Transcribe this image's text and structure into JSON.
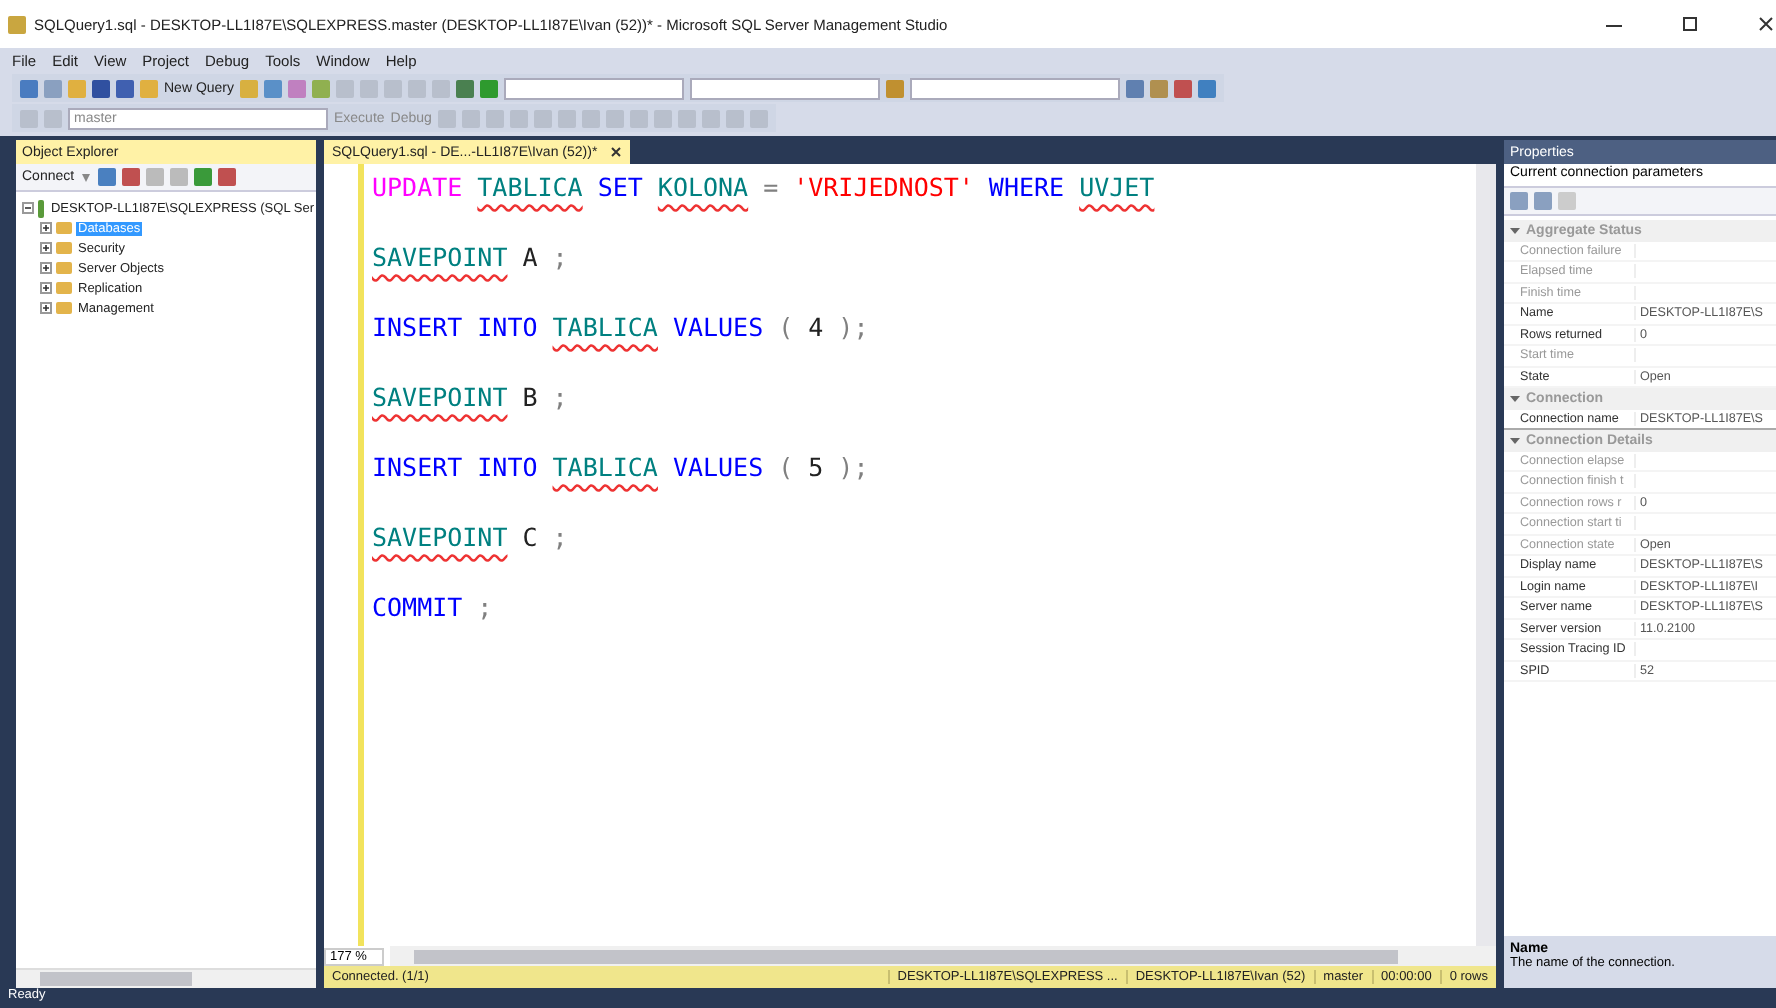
{
  "window": {
    "title": "SQLQuery1.sql - DESKTOP-LL1I87E\\SQLEXPRESS.master (DESKTOP-LL1I87E\\Ivan (52))* - Microsoft SQL Server Management Studio"
  },
  "menu": [
    "File",
    "Edit",
    "View",
    "Project",
    "Debug",
    "Tools",
    "Window",
    "Help"
  ],
  "toolbar": {
    "new_query": "New Query",
    "database": "master",
    "execute": "Execute",
    "debug": "Debug"
  },
  "object_explorer": {
    "title": "Object Explorer",
    "connect": "Connect",
    "tree": [
      {
        "label": "DESKTOP-LL1I87E\\SQLEXPRESS (SQL Ser",
        "expanded": true,
        "selected": false,
        "children": [
          {
            "label": "Databases",
            "expanded": false,
            "selected": true
          },
          {
            "label": "Security",
            "expanded": false,
            "selected": false
          },
          {
            "label": "Server Objects",
            "expanded": false,
            "selected": false
          },
          {
            "label": "Replication",
            "expanded": false,
            "selected": false
          },
          {
            "label": "Management",
            "expanded": false,
            "selected": false
          }
        ]
      }
    ]
  },
  "editor": {
    "tab": {
      "label": "SQLQuery1.sql - DE...-LL1I87E\\Ivan (52))*",
      "selected": true
    },
    "lines": [
      [
        {
          "kind": "special",
          "text": "UPDATE"
        },
        {
          "kind": "ident",
          "text": "TABLICA"
        },
        {
          "kind": "keyword",
          "text": "SET"
        },
        {
          "kind": "ident",
          "text": "KOLONA"
        },
        {
          "kind": "punct",
          "text": "="
        },
        {
          "kind": "string",
          "text": "'VRIJEDNOST'"
        },
        {
          "kind": "keyword",
          "text": "WHERE"
        },
        {
          "kind": "ident",
          "text": "UVJET"
        }
      ],
      [
        {
          "kind": "ident",
          "text": "SAVEPOINT"
        },
        {
          "kind": "plain",
          "text": "A"
        },
        {
          "kind": "punct",
          "text": ";"
        }
      ],
      [
        {
          "kind": "keyword",
          "text": "INSERT"
        },
        {
          "kind": "keyword",
          "text": "INTO"
        },
        {
          "kind": "ident",
          "text": "TABLICA"
        },
        {
          "kind": "keyword",
          "text": "VALUES"
        },
        {
          "kind": "punct",
          "text": "("
        },
        {
          "kind": "plain",
          "text": "4"
        },
        {
          "kind": "punct",
          "text": ");"
        }
      ],
      [
        {
          "kind": "ident",
          "text": "SAVEPOINT"
        },
        {
          "kind": "plain",
          "text": "B"
        },
        {
          "kind": "punct",
          "text": ";"
        }
      ],
      [
        {
          "kind": "keyword",
          "text": "INSERT"
        },
        {
          "kind": "keyword",
          "text": "INTO"
        },
        {
          "kind": "ident",
          "text": "TABLICA"
        },
        {
          "kind": "keyword",
          "text": "VALUES"
        },
        {
          "kind": "punct",
          "text": "("
        },
        {
          "kind": "plain",
          "text": "5"
        },
        {
          "kind": "punct",
          "text": ");"
        }
      ],
      [
        {
          "kind": "ident",
          "text": "SAVEPOINT"
        },
        {
          "kind": "plain",
          "text": "C"
        },
        {
          "kind": "punct",
          "text": ";"
        }
      ],
      [
        {
          "kind": "keyword",
          "text": "COMMIT"
        },
        {
          "kind": "punct",
          "text": ";"
        }
      ]
    ],
    "zoom": "177 %",
    "status": {
      "connected": "Connected. (1/1)",
      "server": "DESKTOP-LL1I87E\\SQLEXPRESS ...",
      "user": "DESKTOP-LL1I87E\\Ivan (52)",
      "database": "master",
      "time": "00:00:00",
      "rows": "0 rows"
    }
  },
  "properties": {
    "title": "Properties",
    "object": "Current connection parameters",
    "sections": [
      {
        "title": "Aggregate Status",
        "expanded": true,
        "rows": [
          {
            "name": "Connection failure",
            "disabled": true,
            "selected": false
          },
          {
            "name": "Elapsed time",
            "disabled": true,
            "selected": false
          },
          {
            "name": "Finish time",
            "disabled": true,
            "selected": false
          },
          {
            "name": "Name",
            "value": "DESKTOP-LL1I87E\\S",
            "disabled": false,
            "selected": false
          },
          {
            "name": "Rows returned",
            "value": "0",
            "disabled": false,
            "selected": false
          },
          {
            "name": "Start time",
            "disabled": true,
            "selected": false
          },
          {
            "name": "State",
            "value": "Open",
            "disabled": false,
            "selected": false
          }
        ]
      },
      {
        "title": "Connection",
        "expanded": true,
        "rows": [
          {
            "name": "Connection name",
            "value": "DESKTOP-LL1I87E\\S",
            "disabled": false,
            "selected": true
          }
        ]
      },
      {
        "title": "Connection Details",
        "expanded": true,
        "rows": [
          {
            "name": "Connection elapse",
            "disabled": true,
            "selected": false
          },
          {
            "name": "Connection finish t",
            "disabled": true,
            "selected": false
          },
          {
            "name": "Connection rows r",
            "value": "0",
            "disabled": true,
            "selected": false
          },
          {
            "name": "Connection start ti",
            "disabled": true,
            "selected": false
          },
          {
            "name": "Connection state",
            "value": "Open",
            "disabled": true,
            "selected": false
          },
          {
            "name": "Display name",
            "value": "DESKTOP-LL1I87E\\S",
            "disabled": false,
            "selected": false
          },
          {
            "name": "Login name",
            "value": "DESKTOP-LL1I87E\\I",
            "disabled": false,
            "selected": false
          },
          {
            "name": "Server name",
            "value": "DESKTOP-LL1I87E\\S",
            "disabled": false,
            "selected": false
          },
          {
            "name": "Server version",
            "value": "11.0.2100",
            "disabled": false,
            "selected": false
          },
          {
            "name": "Session Tracing ID",
            "disabled": false,
            "selected": false
          },
          {
            "name": "SPID",
            "value": "52",
            "disabled": false,
            "selected": false
          }
        ]
      }
    ],
    "description": {
      "title": "Name",
      "text": "The name of the connection."
    }
  },
  "status_bar": "Ready"
}
